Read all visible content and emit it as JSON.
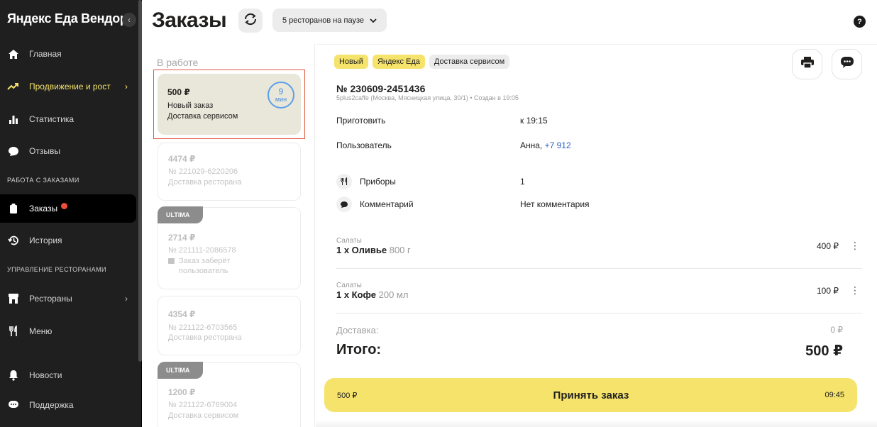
{
  "sidebar": {
    "brand": "Яндекс Еда Вендор",
    "items": [
      {
        "label": "Главная"
      },
      {
        "label": "Продвижение и рост"
      },
      {
        "label": "Статистика"
      },
      {
        "label": "Отзывы"
      },
      {
        "label": "Заказы"
      },
      {
        "label": "История"
      },
      {
        "label": "Рестораны"
      },
      {
        "label": "Меню"
      },
      {
        "label": "Новости"
      },
      {
        "label": "Поддержка"
      }
    ],
    "section_orders": "РАБОТА С ЗАКАЗАМИ",
    "section_restaurants": "УПРАВЛЕНИЕ РЕСТОРАНАМИ"
  },
  "header": {
    "title": "Заказы",
    "pause_label": "5 ресторанов на паузе"
  },
  "orders": {
    "column_label": "В работе",
    "cards": [
      {
        "price": "500 ₽",
        "line1": "Новый заказ",
        "line2": "Доставка сервисом",
        "timer_value": "9",
        "timer_unit": "мин"
      },
      {
        "price": "4474 ₽",
        "line1": "№ 221029-6220206",
        "line2": "Доставка ресторана"
      },
      {
        "badge": "ULTIMA",
        "price": "2714 ₽",
        "line1": "№ 221111-2086578",
        "line2": "Заказ заберёт",
        "line3": "пользователь"
      },
      {
        "price": "4354 ₽",
        "line1": "№ 221122-6703565",
        "line2": "Доставка ресторана"
      },
      {
        "badge": "ULTIMA",
        "price": "1200 ₽",
        "line1": "№ 221122-6769004",
        "line2": "Доставка сервисом"
      }
    ]
  },
  "detail": {
    "tags": [
      "Новый",
      "Яндекс Еда",
      "Доставка сервисом"
    ],
    "order_no": "№ 230609-2451436",
    "order_sub": "5plus2caffe (Москва, Мясницкая улица, 30/1) • Создан в 19:05",
    "rows": [
      {
        "label": "Приготовить",
        "value": "к 19:15"
      },
      {
        "label": "Пользователь",
        "value": "Анна,",
        "phone": "+7 912"
      },
      {
        "label": "Приборы",
        "value": "1"
      },
      {
        "label": "Комментарий",
        "value": "Нет комментария"
      }
    ],
    "items": [
      {
        "category": "Салаты",
        "name": "1 x Оливье",
        "weight": "800 г",
        "price": "400 ₽"
      },
      {
        "category": "Салаты",
        "name": "1 x Кофе",
        "weight": "200 мл",
        "price": "100 ₽"
      }
    ],
    "delivery_label": "Доставка:",
    "delivery_value": "0 ₽",
    "total_label": "Итого:",
    "total_value": "500 ₽",
    "accept": {
      "price": "500 ₽",
      "label": "Принять заказ",
      "time": "09:45"
    }
  },
  "colors": {
    "accent_yellow": "#f5e36b",
    "sidebar_bg": "#1f1f1f",
    "timer_blue": "#5aa0ea",
    "selection_red": "#e05a44"
  }
}
